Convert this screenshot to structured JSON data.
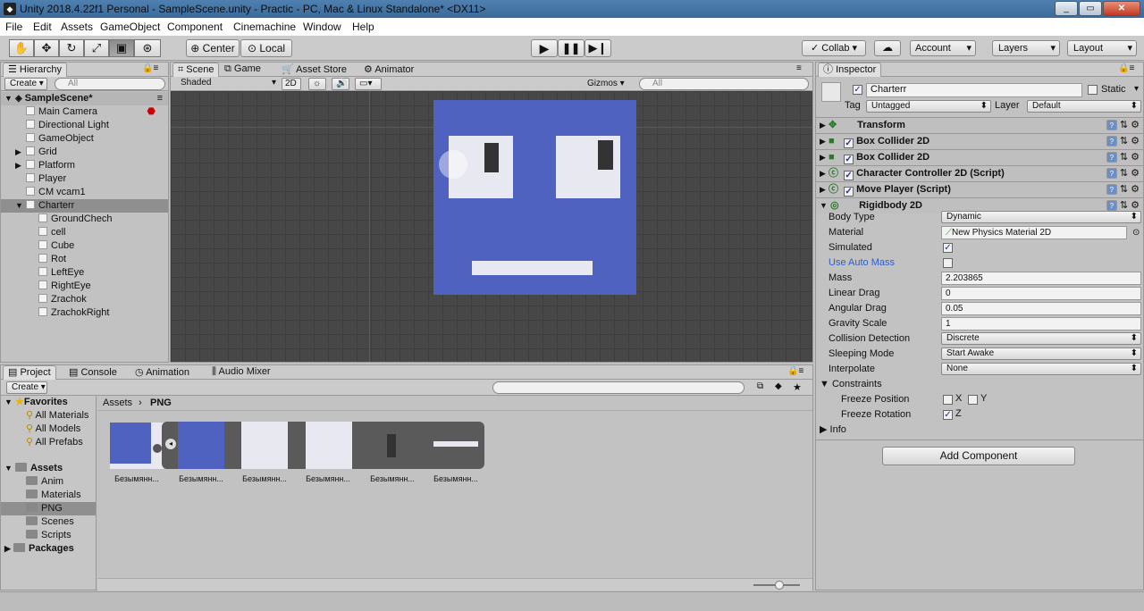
{
  "window": {
    "title": "Unity 2018.4.22f1 Personal - SampleScene.unity - Practic - PC, Mac & Linux Standalone* <DX11>"
  },
  "menu": [
    "File",
    "Edit",
    "Assets",
    "GameObject",
    "Component",
    "Cinemachine",
    "Window",
    "Help"
  ],
  "toolbar": {
    "center_label": "Center",
    "local_label": "Local",
    "collab_label": "Collab ▾",
    "account_label": "Account",
    "layers_label": "Layers",
    "layout_label": "Layout"
  },
  "hierarchy": {
    "tab": "Hierarchy",
    "create": "Create",
    "search_placeholder": "All",
    "scene": "SampleScene*",
    "items": [
      {
        "label": "Main Camera",
        "indent": 1
      },
      {
        "label": "Directional Light",
        "indent": 1
      },
      {
        "label": "GameObject",
        "indent": 1
      },
      {
        "label": "Grid",
        "indent": 1
      },
      {
        "label": "Platform",
        "indent": 1
      },
      {
        "label": "Player",
        "indent": 1
      },
      {
        "label": "CM vcam1",
        "indent": 1
      },
      {
        "label": "Charterr",
        "indent": 1
      },
      {
        "label": "GroundChech",
        "indent": 2
      },
      {
        "label": "cell",
        "indent": 2
      },
      {
        "label": "Cube",
        "indent": 2
      },
      {
        "label": "Rot",
        "indent": 2
      },
      {
        "label": "LeftEye",
        "indent": 2
      },
      {
        "label": "RightEye",
        "indent": 2
      },
      {
        "label": "Zrachok",
        "indent": 2
      },
      {
        "label": "ZrachokRight",
        "indent": 2
      }
    ]
  },
  "scene": {
    "tabs": [
      "Scene",
      "Game",
      "Asset Store",
      "Animator"
    ],
    "shading": "Shaded",
    "mode2d": "2D",
    "gizmos": "Gizmos",
    "search_placeholder": "All",
    "character_color": "#5062c0"
  },
  "inspector": {
    "tab": "Inspector",
    "name": "Charterr",
    "static": "Static",
    "tag_label": "Tag",
    "tag": "Untagged",
    "layer_label": "Layer",
    "layer": "Default",
    "components": [
      "Transform",
      "Box Collider 2D",
      "Box Collider 2D",
      "Character Controller 2D (Script)",
      "Move Player (Script)",
      "Rigidbody 2D"
    ],
    "props": [
      {
        "label": "Body Type",
        "value": "Dynamic"
      },
      {
        "label": "Material",
        "value": "New Physics Material 2D"
      },
      {
        "label": "Simulated",
        "value": ""
      },
      {
        "label": "Use Auto Mass",
        "value": ""
      },
      {
        "label": "Mass",
        "value": "2.203865"
      },
      {
        "label": "Linear Drag",
        "value": "0"
      },
      {
        "label": "Angular Drag",
        "value": "0.05"
      },
      {
        "label": "Gravity Scale",
        "value": "1"
      },
      {
        "label": "Collision Detection",
        "value": "Discrete"
      },
      {
        "label": "Sleeping Mode",
        "value": "Start Awake"
      },
      {
        "label": "Interpolate",
        "value": "None"
      }
    ],
    "constraints": "Constraints",
    "freeze_position": "Freeze Position",
    "freeze_rotation": "Freeze Rotation",
    "x": "X",
    "y": "Y",
    "z": "Z",
    "info": "Info",
    "add_component": "Add Component"
  },
  "project": {
    "tabs": [
      "Project",
      "Console",
      "Animation",
      "Audio Mixer"
    ],
    "create": "Create",
    "favorites": "Favorites",
    "fav_items": [
      "All Materials",
      "All Models",
      "All Prefabs"
    ],
    "assets": "Assets",
    "asset_items": [
      "Anim",
      "Materials",
      "PNG",
      "Scenes",
      "Scripts"
    ],
    "packages": "Packages",
    "breadcrumb_root": "Assets",
    "breadcrumb_leaf": "PNG",
    "thumb_label": "Безымянн..."
  }
}
